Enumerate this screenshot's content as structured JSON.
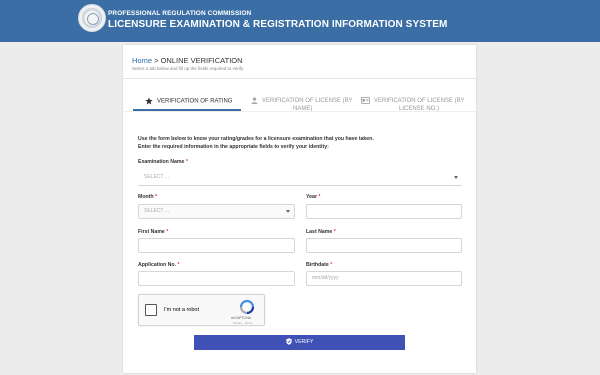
{
  "header": {
    "title_line1": "PROFESSIONAL REGULATION COMMISSION",
    "title_line2": "LICENSURE EXAMINATION & REGISTRATION INFORMATION SYSTEM",
    "logo_icon": "prc-seal-icon"
  },
  "breadcrumb": {
    "home": "Home",
    "separator": ">",
    "current": "ONLINE VERIFICATION",
    "subtitle": "Select a tab below and fill up the fields required to verify"
  },
  "tabs": [
    {
      "label": "VERIFICATION OF RATING",
      "icon": "star-icon",
      "active": true
    },
    {
      "label_line1": "VERIFICATION OF LICENSE (BY",
      "label_line2": "NAME)",
      "icon": "person-icon",
      "active": false
    },
    {
      "label_line1": "VERIFICATION OF LICENSE (BY",
      "label_line2": "LICENSE NO.)",
      "icon": "id-card-icon",
      "active": false
    }
  ],
  "intro": {
    "line1": "Use the form below to know your rating/grades for a licensure examination that you have taken.",
    "line2": "Enter the required information in the appropriate fields to verify your identity:"
  },
  "form": {
    "required_mark": "*",
    "exam_name": {
      "label": "Examination Name",
      "placeholder": "SELECT ....",
      "value": "SELECT ...."
    },
    "month": {
      "label": "Month",
      "value": "SELECT ...."
    },
    "year": {
      "label": "Year",
      "value": ""
    },
    "first_name": {
      "label": "First Name",
      "value": ""
    },
    "last_name": {
      "label": "Last Name",
      "value": ""
    },
    "application_no": {
      "label": "Application No.",
      "value": ""
    },
    "birthdate": {
      "label": "Birthdate",
      "placeholder": "mm/dd/yyyy"
    }
  },
  "recaptcha": {
    "label": "I'm not a robot",
    "brand": "reCAPTCHA",
    "terms": "Privacy - Terms"
  },
  "verify_button": {
    "label": "VERIFY",
    "icon": "shield-check-icon",
    "color": "#3f51b5"
  },
  "colors": {
    "header_bg": "#3a6ea5",
    "accent": "#3a6ea5",
    "required": "#e53935"
  }
}
